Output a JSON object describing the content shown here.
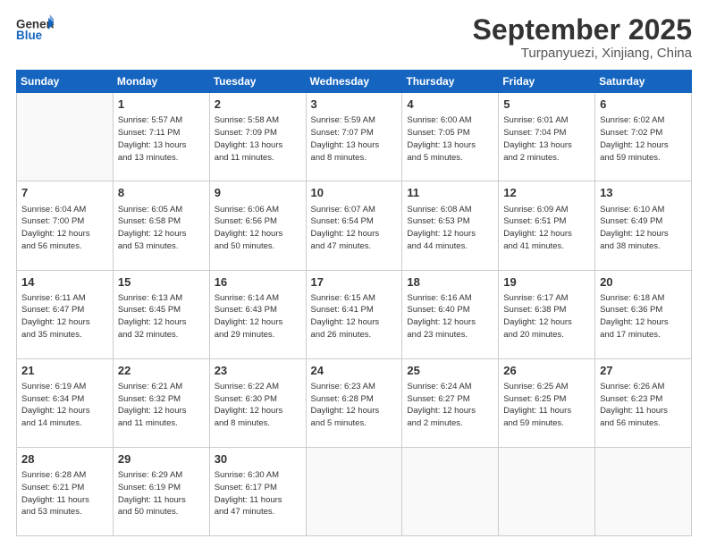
{
  "header": {
    "logo_general": "General",
    "logo_blue": "Blue",
    "month": "September 2025",
    "location": "Turpanyuezi, Xinjiang, China"
  },
  "weekdays": [
    "Sunday",
    "Monday",
    "Tuesday",
    "Wednesday",
    "Thursday",
    "Friday",
    "Saturday"
  ],
  "weeks": [
    [
      {
        "day": "",
        "info": ""
      },
      {
        "day": "1",
        "info": "Sunrise: 5:57 AM\nSunset: 7:11 PM\nDaylight: 13 hours\nand 13 minutes."
      },
      {
        "day": "2",
        "info": "Sunrise: 5:58 AM\nSunset: 7:09 PM\nDaylight: 13 hours\nand 11 minutes."
      },
      {
        "day": "3",
        "info": "Sunrise: 5:59 AM\nSunset: 7:07 PM\nDaylight: 13 hours\nand 8 minutes."
      },
      {
        "day": "4",
        "info": "Sunrise: 6:00 AM\nSunset: 7:05 PM\nDaylight: 13 hours\nand 5 minutes."
      },
      {
        "day": "5",
        "info": "Sunrise: 6:01 AM\nSunset: 7:04 PM\nDaylight: 13 hours\nand 2 minutes."
      },
      {
        "day": "6",
        "info": "Sunrise: 6:02 AM\nSunset: 7:02 PM\nDaylight: 12 hours\nand 59 minutes."
      }
    ],
    [
      {
        "day": "7",
        "info": "Sunrise: 6:04 AM\nSunset: 7:00 PM\nDaylight: 12 hours\nand 56 minutes."
      },
      {
        "day": "8",
        "info": "Sunrise: 6:05 AM\nSunset: 6:58 PM\nDaylight: 12 hours\nand 53 minutes."
      },
      {
        "day": "9",
        "info": "Sunrise: 6:06 AM\nSunset: 6:56 PM\nDaylight: 12 hours\nand 50 minutes."
      },
      {
        "day": "10",
        "info": "Sunrise: 6:07 AM\nSunset: 6:54 PM\nDaylight: 12 hours\nand 47 minutes."
      },
      {
        "day": "11",
        "info": "Sunrise: 6:08 AM\nSunset: 6:53 PM\nDaylight: 12 hours\nand 44 minutes."
      },
      {
        "day": "12",
        "info": "Sunrise: 6:09 AM\nSunset: 6:51 PM\nDaylight: 12 hours\nand 41 minutes."
      },
      {
        "day": "13",
        "info": "Sunrise: 6:10 AM\nSunset: 6:49 PM\nDaylight: 12 hours\nand 38 minutes."
      }
    ],
    [
      {
        "day": "14",
        "info": "Sunrise: 6:11 AM\nSunset: 6:47 PM\nDaylight: 12 hours\nand 35 minutes."
      },
      {
        "day": "15",
        "info": "Sunrise: 6:13 AM\nSunset: 6:45 PM\nDaylight: 12 hours\nand 32 minutes."
      },
      {
        "day": "16",
        "info": "Sunrise: 6:14 AM\nSunset: 6:43 PM\nDaylight: 12 hours\nand 29 minutes."
      },
      {
        "day": "17",
        "info": "Sunrise: 6:15 AM\nSunset: 6:41 PM\nDaylight: 12 hours\nand 26 minutes."
      },
      {
        "day": "18",
        "info": "Sunrise: 6:16 AM\nSunset: 6:40 PM\nDaylight: 12 hours\nand 23 minutes."
      },
      {
        "day": "19",
        "info": "Sunrise: 6:17 AM\nSunset: 6:38 PM\nDaylight: 12 hours\nand 20 minutes."
      },
      {
        "day": "20",
        "info": "Sunrise: 6:18 AM\nSunset: 6:36 PM\nDaylight: 12 hours\nand 17 minutes."
      }
    ],
    [
      {
        "day": "21",
        "info": "Sunrise: 6:19 AM\nSunset: 6:34 PM\nDaylight: 12 hours\nand 14 minutes."
      },
      {
        "day": "22",
        "info": "Sunrise: 6:21 AM\nSunset: 6:32 PM\nDaylight: 12 hours\nand 11 minutes."
      },
      {
        "day": "23",
        "info": "Sunrise: 6:22 AM\nSunset: 6:30 PM\nDaylight: 12 hours\nand 8 minutes."
      },
      {
        "day": "24",
        "info": "Sunrise: 6:23 AM\nSunset: 6:28 PM\nDaylight: 12 hours\nand 5 minutes."
      },
      {
        "day": "25",
        "info": "Sunrise: 6:24 AM\nSunset: 6:27 PM\nDaylight: 12 hours\nand 2 minutes."
      },
      {
        "day": "26",
        "info": "Sunrise: 6:25 AM\nSunset: 6:25 PM\nDaylight: 11 hours\nand 59 minutes."
      },
      {
        "day": "27",
        "info": "Sunrise: 6:26 AM\nSunset: 6:23 PM\nDaylight: 11 hours\nand 56 minutes."
      }
    ],
    [
      {
        "day": "28",
        "info": "Sunrise: 6:28 AM\nSunset: 6:21 PM\nDaylight: 11 hours\nand 53 minutes."
      },
      {
        "day": "29",
        "info": "Sunrise: 6:29 AM\nSunset: 6:19 PM\nDaylight: 11 hours\nand 50 minutes."
      },
      {
        "day": "30",
        "info": "Sunrise: 6:30 AM\nSunset: 6:17 PM\nDaylight: 11 hours\nand 47 minutes."
      },
      {
        "day": "",
        "info": ""
      },
      {
        "day": "",
        "info": ""
      },
      {
        "day": "",
        "info": ""
      },
      {
        "day": "",
        "info": ""
      }
    ]
  ]
}
